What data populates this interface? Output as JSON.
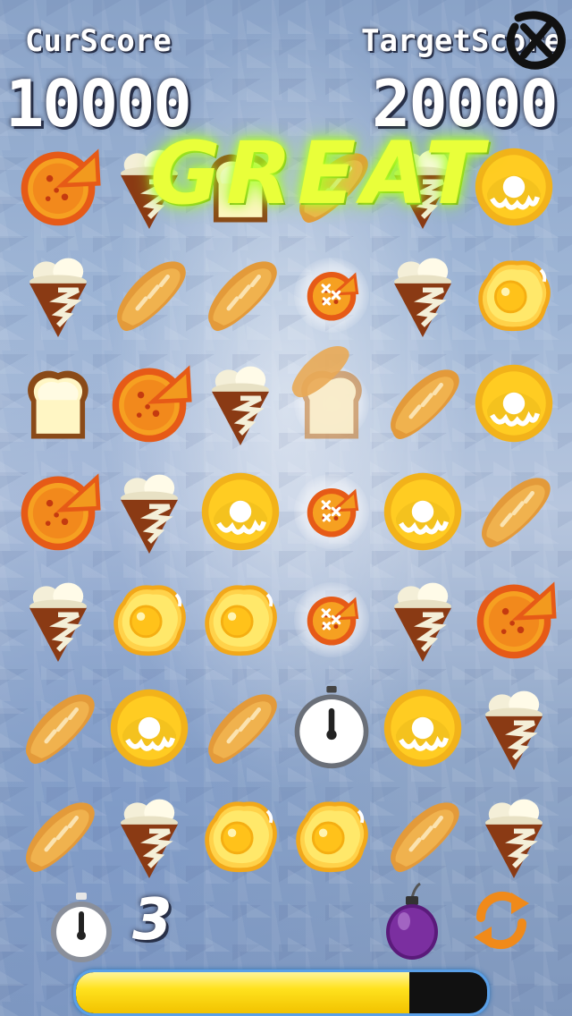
{
  "hud": {
    "current_score_label": "CurScore",
    "current_score_value": "10000",
    "target_score_label": "TargetScore",
    "target_score_value": "20000"
  },
  "banner": {
    "text": "GREAT"
  },
  "board": {
    "columns": 6,
    "rows": 7,
    "cells": [
      [
        "pizza",
        "icecream",
        "toast",
        "bread",
        "icecream",
        "donut"
      ],
      [
        "icecream",
        "bread",
        "bread",
        "pizza-exploding",
        "icecream",
        "egg"
      ],
      [
        "toast",
        "pizza",
        "icecream",
        "toast-bread-falling",
        "bread",
        "donut"
      ],
      [
        "pizza",
        "icecream",
        "donut",
        "pizza-exploding",
        "donut",
        "bread"
      ],
      [
        "icecream",
        "egg",
        "egg",
        "pizza-exploding",
        "icecream",
        "pizza"
      ],
      [
        "bread",
        "donut",
        "bread",
        "stopwatch",
        "donut",
        "icecream"
      ],
      [
        "bread",
        "icecream",
        "egg",
        "egg",
        "bread",
        "icecream"
      ]
    ]
  },
  "footer": {
    "moves_left": "3",
    "progress_fraction": 0.81
  },
  "colors": {
    "progress_fill": "#ffe21e",
    "great_text": "#e9ff3a",
    "progress_border": "#5aa0e8"
  }
}
